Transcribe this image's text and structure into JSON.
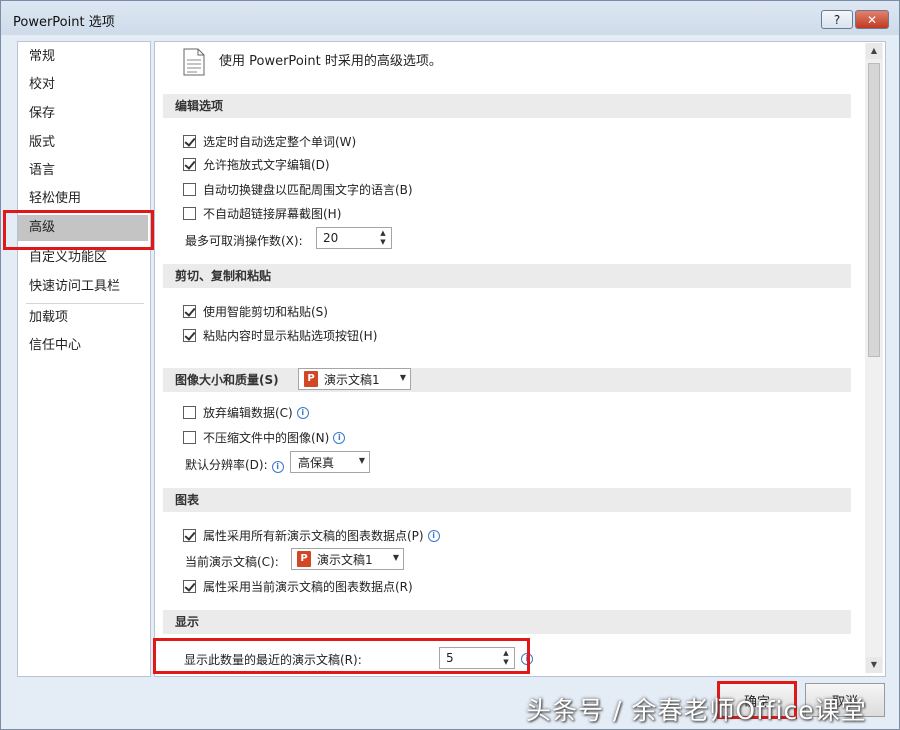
{
  "window": {
    "title": "PowerPoint 选项",
    "help_label": "?",
    "close_label": "✕"
  },
  "sidebar": {
    "items": [
      {
        "label": "常规"
      },
      {
        "label": "校对"
      },
      {
        "label": "保存"
      },
      {
        "label": "版式"
      },
      {
        "label": "语言"
      },
      {
        "label": "轻松使用"
      },
      {
        "label": "高级",
        "selected": true
      },
      {
        "label": "自定义功能区"
      },
      {
        "label": "快速访问工具栏"
      },
      {
        "label": "加载项"
      },
      {
        "label": "信任中心"
      }
    ]
  },
  "main": {
    "heading": "使用 PowerPoint 时采用的高级选项。",
    "editing": {
      "title": "编辑选项",
      "auto_select_word": {
        "label": "选定时自动选定整个单词(W)",
        "checked": true
      },
      "drag_drop": {
        "label": "允许拖放式文字编辑(D)",
        "checked": true
      },
      "auto_keyboard": {
        "label": "自动切换键盘以匹配周围文字的语言(B)",
        "checked": false
      },
      "no_hyperlink": {
        "label": "不自动超链接屏幕截图(H)",
        "checked": false
      },
      "undo_label": "最多可取消操作数(X):",
      "undo_value": "20"
    },
    "clipboard": {
      "title": "剪切、复制和粘贴",
      "smart_cut": {
        "label": "使用智能剪切和粘贴(S)",
        "checked": true
      },
      "paste_options": {
        "label": "粘贴内容时显示粘贴选项按钮(H)",
        "checked": true
      }
    },
    "image": {
      "title": "图像大小和质量(S)",
      "doc_select": "演示文稿1",
      "discard_edit": {
        "label": "放弃编辑数据(C)",
        "checked": false
      },
      "no_compress": {
        "label": "不压缩文件中的图像(N)",
        "checked": false
      },
      "resolution_label": "默认分辨率(D):",
      "resolution_value": "高保真"
    },
    "chart": {
      "title": "图表",
      "props_all_new": {
        "label": "属性采用所有新演示文稿的图表数据点(P)",
        "checked": true
      },
      "current_label": "当前演示文稿(C):",
      "current_value": "演示文稿1",
      "props_current": {
        "label": "属性采用当前演示文稿的图表数据点(R)",
        "checked": true
      }
    },
    "display": {
      "title": "显示",
      "recent_label": "显示此数量的最近的演示文稿(R):",
      "recent_value": "5"
    }
  },
  "buttons": {
    "ok": "确定",
    "cancel": "取消"
  },
  "watermark": "头条号 / 余春老师Office课堂",
  "icons": {
    "ppt": "P",
    "info": "i"
  },
  "colors": {
    "highlight": "#e01818",
    "ppt_accent": "#d24726",
    "info_blue": "#3a78c8"
  }
}
